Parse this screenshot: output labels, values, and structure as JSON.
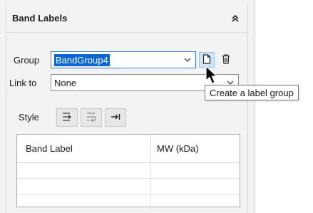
{
  "panel": {
    "title": "Band Labels",
    "collapse_icon": "double-chevron-up-icon"
  },
  "group": {
    "label": "Group",
    "value": "BandGroup4",
    "new_icon": "new-document-icon",
    "delete_icon": "trash-icon"
  },
  "link": {
    "label": "Link to",
    "value": "None"
  },
  "style": {
    "label": "Style",
    "buttons": [
      "align-left-arrow-icon",
      "wrap-arrow-icon",
      "tab-right-icon"
    ]
  },
  "table": {
    "columns": [
      "Band Label",
      "MW (kDa)"
    ],
    "rows": [
      [
        "",
        ""
      ],
      [
        "",
        ""
      ],
      [
        "",
        ""
      ]
    ]
  },
  "tooltip": {
    "text": "Create a label group"
  },
  "colors": {
    "selection": "#0b66d6",
    "hover_button": "#cde3f7",
    "panel_bg": "#f3f3f3"
  }
}
